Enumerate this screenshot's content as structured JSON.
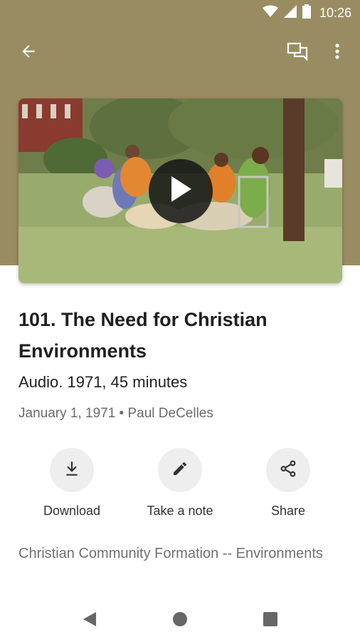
{
  "status_bar": {
    "time": "10:26",
    "icons": [
      "wifi-icon",
      "signal-icon",
      "battery-icon"
    ]
  },
  "app_bar": {
    "back_icon": "arrow-left-icon",
    "actions": [
      "chat-bubbles-icon",
      "more-vert-icon"
    ]
  },
  "media": {
    "play_icon": "play-icon"
  },
  "item": {
    "title": "101. The Need for Christian Environments",
    "subtitle": "Audio. 1971, 45 minutes",
    "meta": "January 1, 1971 • Paul DeCelles"
  },
  "actions": [
    {
      "label": "Download",
      "icon": "download-icon"
    },
    {
      "label": "Take a note",
      "icon": "pencil-icon"
    },
    {
      "label": "Share",
      "icon": "share-icon"
    }
  ],
  "collection": "Christian Community Formation -- Environments",
  "nav": [
    "back-triangle-icon",
    "home-circle-icon",
    "recents-square-icon"
  ],
  "colors": {
    "header": "#9a8c62",
    "icon_circle": "#eeeeee",
    "meta_text": "#6b6b6b"
  }
}
